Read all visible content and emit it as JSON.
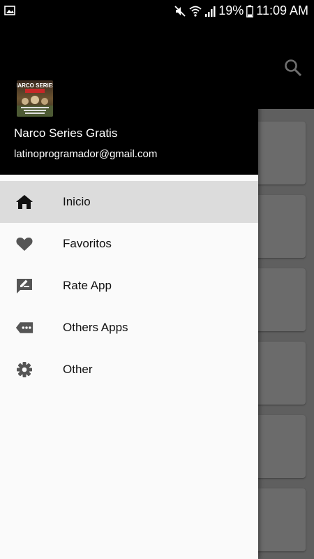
{
  "status_bar": {
    "battery_text": "19%",
    "time": "11:09 AM"
  },
  "app_bar": {
    "search_icon": "search-icon"
  },
  "drawer": {
    "header": {
      "title": "Narco Series Gratis",
      "email": "latinoprogramador@gmail.com",
      "logo_caption": "NARCO SERIES"
    },
    "items": [
      {
        "label": "Inicio",
        "icon": "home-icon",
        "active": true
      },
      {
        "label": "Favoritos",
        "icon": "heart-icon",
        "active": false
      },
      {
        "label": "Rate App",
        "icon": "rate-app-icon",
        "active": false
      },
      {
        "label": "Others Apps",
        "icon": "more-apps-icon",
        "active": false
      },
      {
        "label": "Other",
        "icon": "settings-gear-icon",
        "active": false
      }
    ]
  },
  "colors": {
    "drawer_bg": "#fafafa",
    "header_bg": "#000000",
    "active_item_bg": "#dcdcdc",
    "icon_gray": "#555555",
    "content_bg": "#5f5f5f"
  }
}
